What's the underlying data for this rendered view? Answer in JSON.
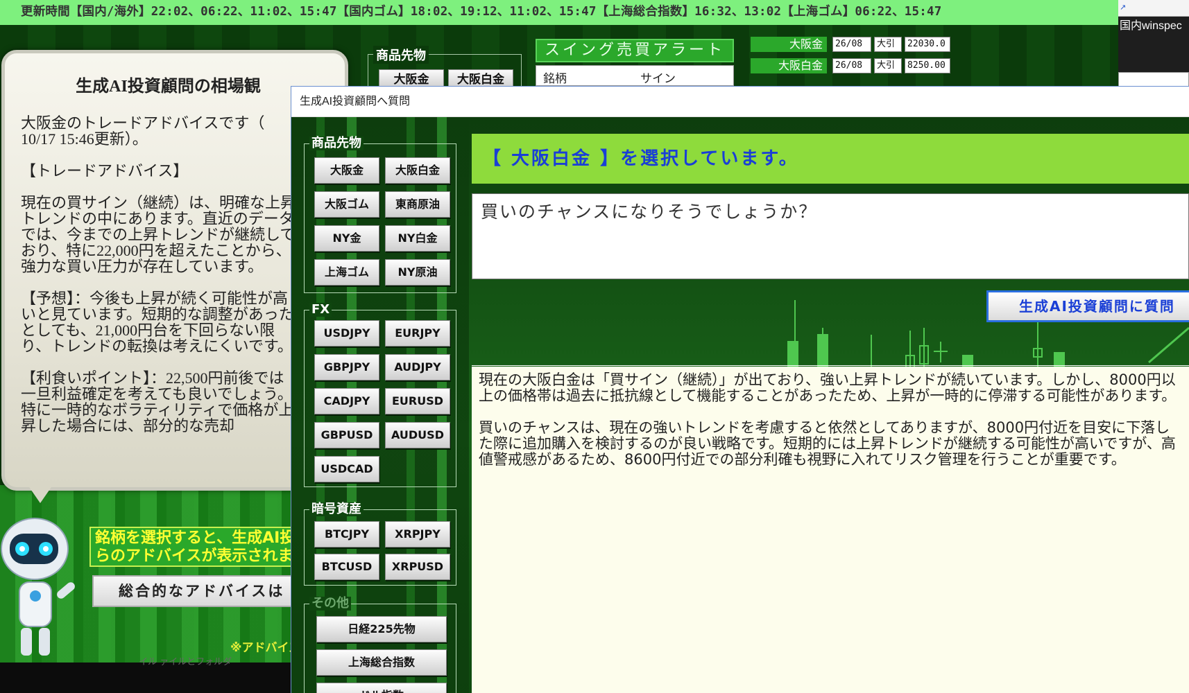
{
  "ticker": {
    "text": "更新時間【国内/海外】22:02、06:22、11:02、15:47【国内ゴム】18:02、19:12、11:02、15:47【上海総合指数】16:32、13:02【上海ゴム】06:22、15:47"
  },
  "desktop": {
    "shortcut_label": "国内winspec"
  },
  "background_app": {
    "advice_title": "生成AI投資顧問の相場観",
    "advice_text": "大阪金のトレードアドバイスです（\n10/17 15:46更新）。\n\n【トレードアドバイス】\n\n現在の買サイン（継続）は、明確な上昇トレンドの中にあります。直近のデータでは、今までの上昇トレンドが継続しており、特に22,000円を超えたことから、強力な買い圧力が存在しています。\n\n【予想】：今後も上昇が続く可能性が高いと見ています。短期的な調整があったとしても、21,000円台を下回らない限り、トレンドの転換は考えにくいです。\n\n【利食いポイント】：22,500円前後では一旦利益確定を考えても良いでしょう。特に一時的なボラティリティで価格が上昇した場合には、部分的な売却",
    "hint_text": "銘柄を選択すると、生成AI投\nらのアドバイスが表示されます。",
    "overall_button": "総合的なアドバイスは",
    "note": "※アドバイス",
    "bottom_text": "イル                    ァイルとフォルダ",
    "group_label": "商品先物",
    "group_buttons": [
      "大阪金",
      "大阪白金"
    ],
    "alert_title": "スイング売買アラート",
    "alert_columns": [
      "銘柄",
      "サイン"
    ],
    "prices": [
      {
        "name": "大阪金",
        "date": "26/08",
        "type": "大引",
        "value": "22030.0"
      },
      {
        "name": "大阪白金",
        "date": "26/08",
        "type": "大引",
        "value": "8250.00"
      }
    ]
  },
  "dialog": {
    "title": "生成AI投資顧問へ質問",
    "groups": {
      "commodities": {
        "label": "商品先物",
        "buttons": [
          "大阪金",
          "大阪白金",
          "大阪ゴム",
          "東商原油",
          "NY金",
          "NY白金",
          "上海ゴム",
          "NY原油"
        ]
      },
      "fx": {
        "label": "FX",
        "buttons": [
          "USDJPY",
          "EURJPY",
          "GBPJPY",
          "AUDJPY",
          "CADJPY",
          "EURUSD",
          "GBPUSD",
          "AUDUSD",
          "USDCAD"
        ]
      },
      "crypto": {
        "label": "暗号資産",
        "buttons": [
          "BTCJPY",
          "XRPJPY",
          "BTCUSD",
          "XRPUSD"
        ]
      },
      "other": {
        "label": "その他",
        "buttons": [
          "日経225先物",
          "上海総合指数",
          "ドル指数"
        ]
      }
    },
    "selected_text": "【 大阪白金 】を選択しています。",
    "question_text": "買いのチャンスになりそうでしょうか？",
    "ask_button": "生成AI投資顧問に質問",
    "answer_text": "現在の大阪白金は「買サイン（継続）」が出ており、強い上昇トレンドが続いています。しかし、8000円以上の価格帯は過去に抵抗線として機能することがあったため、上昇が一時的に停滞する可能性があります。\n\n買いのチャンスは、現在の強いトレンドを考慮すると依然としてありますが、8000円付近を目安に下落した際に追加購入を検討するのが良い戦略です。短期的には上昇トレンドが継続する可能性が高いですが、高値警戒感があるため、8600円付近での部分利確も視野に入れてリスク管理を行うことが重要です。"
  },
  "colors": {
    "ticker_bg": "#7ef07e",
    "accent_green": "#8edb3c",
    "accent_blue": "#1a3fd6",
    "answer_bg": "#fdfdec"
  }
}
